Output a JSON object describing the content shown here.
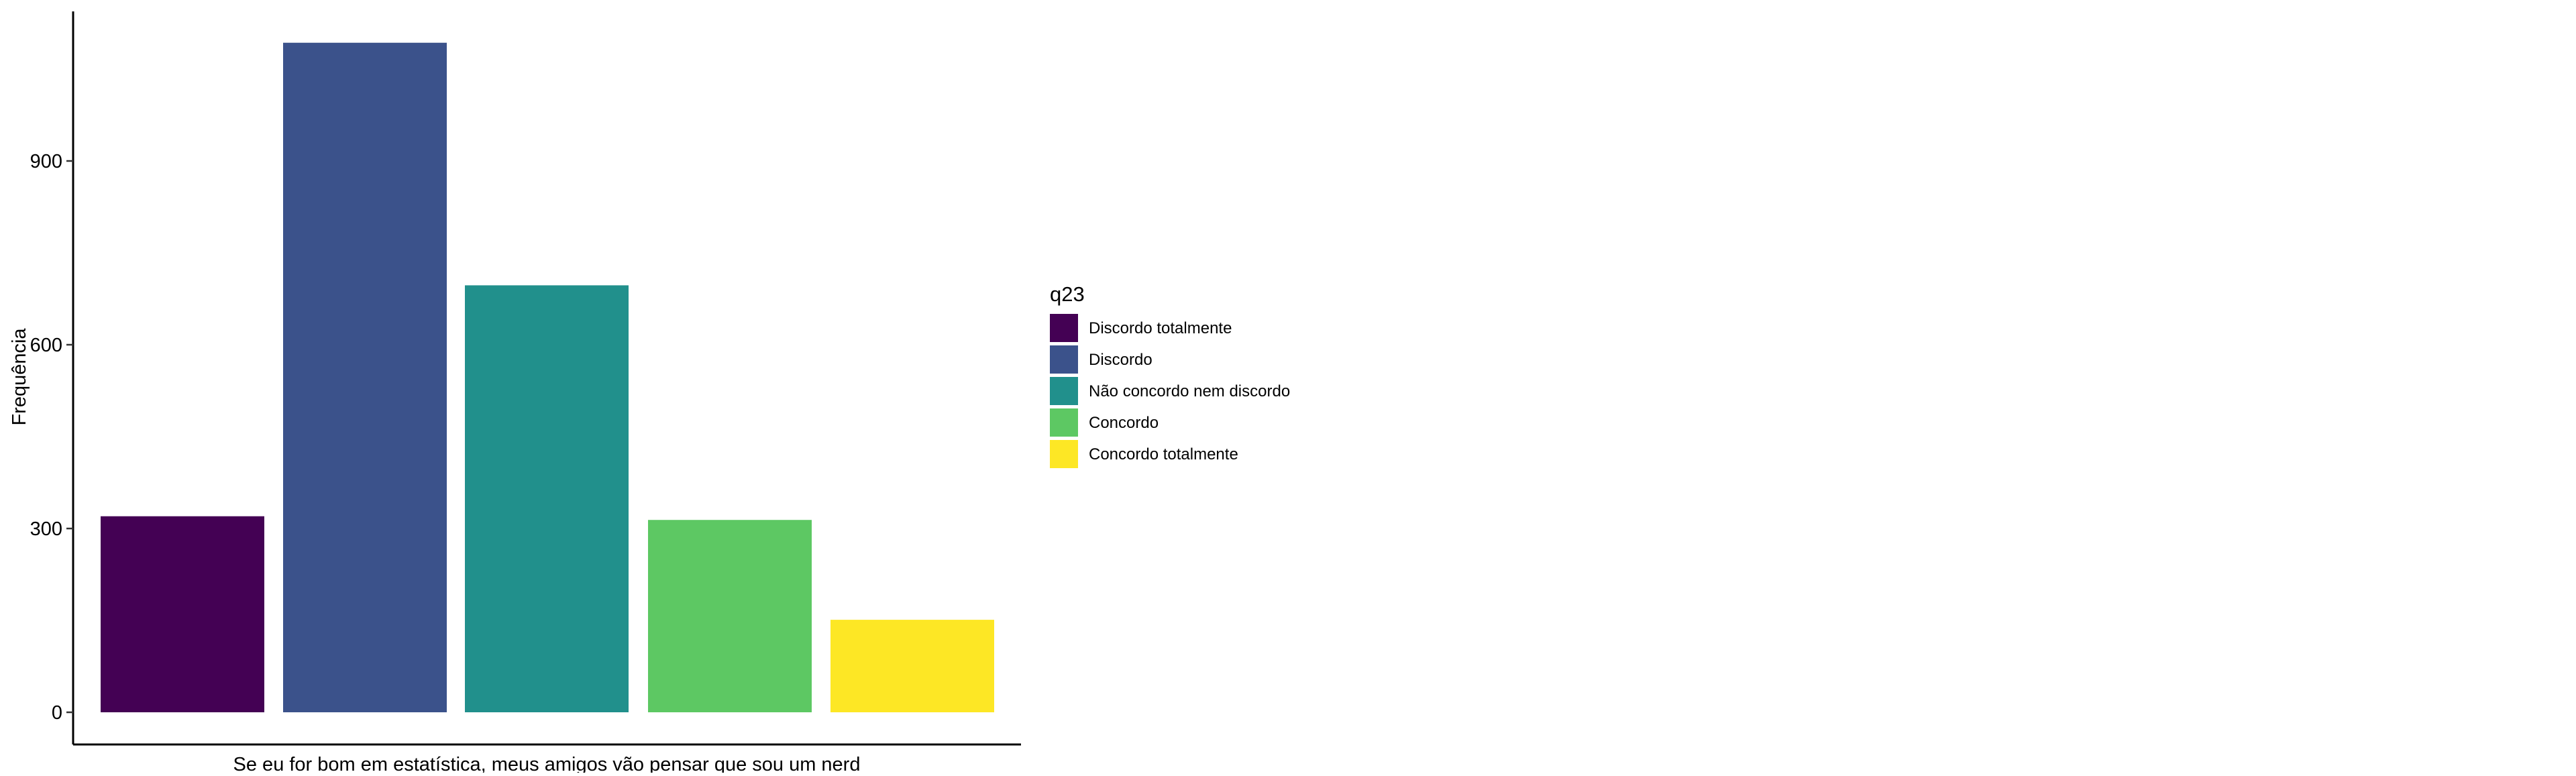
{
  "chart_data": {
    "type": "bar",
    "xlabel": "Se eu for bom em estatística, meus amigos vão pensar que sou um nerd",
    "ylabel": "Frequência",
    "categories": [
      "Discordo totalmente",
      "Discordo",
      "Não concordo nem discordo",
      "Concordo",
      "Concordo totalmente"
    ],
    "values": [
      320,
      1093,
      697,
      314,
      151
    ],
    "colors": [
      "#440154",
      "#3B528B",
      "#21908C",
      "#5DC863",
      "#FDE725"
    ],
    "ylim": [
      0,
      1150
    ],
    "yticks": [
      0,
      300,
      600,
      900
    ],
    "xticks_shown": false,
    "grid": false,
    "legend": {
      "title": "q23",
      "position": "right"
    }
  }
}
